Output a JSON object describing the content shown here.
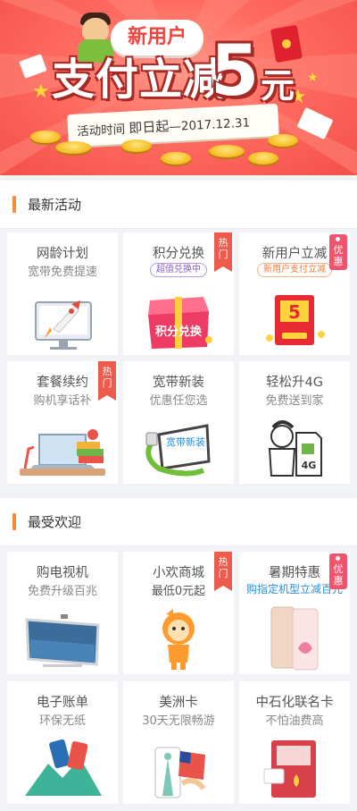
{
  "banner": {
    "badge": "新用户",
    "headline": "支付立减",
    "amount": "5",
    "unit": "元",
    "period_label": "活动时间",
    "period_value": "即日起",
    "period_end": "—2017.12.31"
  },
  "sections": [
    {
      "title": "最新活动",
      "cards": [
        {
          "title": "网龄计划",
          "subtitle": "宽带免费提速",
          "tag": "",
          "art": "rocket-monitor-icon"
        },
        {
          "title": "积分兑换",
          "pill": "超值兑换中",
          "tag": "热门",
          "art": "points-gift-box-icon",
          "art_text": "积分兑换"
        },
        {
          "title": "新用户立减",
          "pill": "新用户支付立减",
          "tag": "优惠",
          "art": "red-envelope-icon",
          "art_text": "5"
        },
        {
          "title": "套餐续约",
          "subtitle": "购机享话补",
          "tag": "热门",
          "art": "laptop-books-icon"
        },
        {
          "title": "宽带新装",
          "subtitle": "优惠任您选",
          "tag": "",
          "art": "broadband-monitor-icon",
          "art_text": "宽带新装"
        },
        {
          "title": "轻松升4G",
          "subtitle": "免费送到家",
          "tag": "",
          "art": "sim-card-4g-icon",
          "art_text": "4G"
        }
      ]
    },
    {
      "title": "最受欢迎",
      "cards": [
        {
          "title": "购电视机",
          "subtitle": "免费升级百兆",
          "tag": "",
          "art": "television-icon"
        },
        {
          "title": "小欢商城",
          "subtitle": "最低0元起",
          "tag": "热门",
          "art": "mascot-icon"
        },
        {
          "title": "暑期特惠",
          "subtitle": "购指定机型立减百元",
          "tag": "优惠",
          "art": "smartphone-icon"
        },
        {
          "title": "电子账单",
          "subtitle": "环保无纸",
          "tag": "",
          "art": "phone-bill-icon"
        },
        {
          "title": "美洲卡",
          "subtitle": "30天无限畅游",
          "tag": "",
          "art": "statue-of-liberty-phone-icon"
        },
        {
          "title": "中石化联名卡",
          "subtitle": "不怕油费高",
          "tag": "",
          "art": "fuel-card-icon"
        }
      ]
    }
  ],
  "colors": {
    "accent": "#fa8b3b",
    "hot_tag": "#ee5a4b",
    "youhui_tag": "#f2546d",
    "banner_red": "#f3504a"
  }
}
